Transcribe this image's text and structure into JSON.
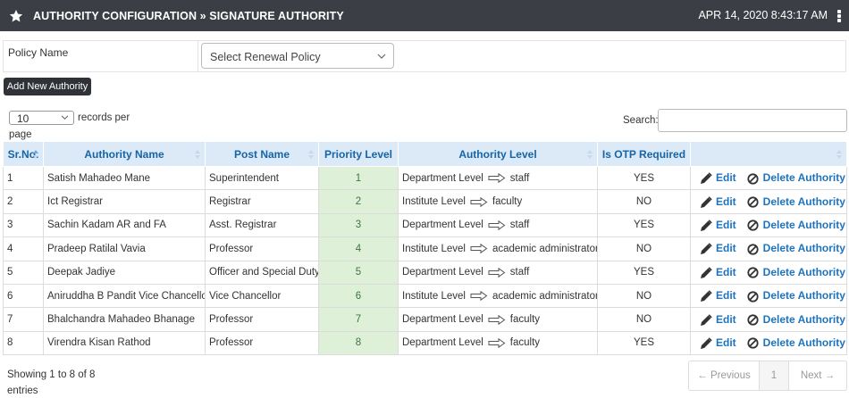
{
  "header": {
    "title": "AUTHORITY CONFIGURATION » SIGNATURE AUTHORITY",
    "datetime": "APR 14, 2020  8:43:17 AM",
    "icons": [
      "star-icon",
      "kebab-menu-icon"
    ],
    "bg_color": "#3b3f45"
  },
  "policy": {
    "label": "Policy Name",
    "select_value": "Select Renewal Policy"
  },
  "add_button_label": "Add New Authority",
  "length_menu": {
    "value": "10",
    "label_part1": "records per",
    "label_part2": "page"
  },
  "search": {
    "label": "Search:",
    "value": ""
  },
  "table": {
    "columns": [
      "Sr.No.",
      "Authority Name",
      "Post Name",
      "Priority Level",
      "Authority Level",
      "Is OTP Required",
      ""
    ],
    "rows": [
      {
        "sr": "1",
        "name": "Satish Mahadeo Mane",
        "post": "Superintendent",
        "priority": "1",
        "level_from": "Department Level",
        "level_to": "staff",
        "otp": "YES"
      },
      {
        "sr": "2",
        "name": "Ict Registrar",
        "post": "Registrar",
        "priority": "2",
        "level_from": "Institute Level",
        "level_to": "faculty",
        "otp": "NO"
      },
      {
        "sr": "3",
        "name": "Sachin Kadam AR and FA",
        "post": "Asst. Registrar",
        "priority": "3",
        "level_from": "Department Level",
        "level_to": "staff",
        "otp": "YES"
      },
      {
        "sr": "4",
        "name": "Pradeep Ratilal Vavia",
        "post": "Professor",
        "priority": "4",
        "level_from": "Institute Level",
        "level_to": "academic administrator",
        "otp": "NO"
      },
      {
        "sr": "5",
        "name": "Deepak Jadiye",
        "post": "Officer and Special Duty",
        "priority": "5",
        "level_from": "Department Level",
        "level_to": "staff",
        "otp": "YES"
      },
      {
        "sr": "6",
        "name": "Aniruddha B Pandit Vice Chancellor",
        "post": "Vice Chancellor",
        "priority": "6",
        "level_from": "Institute Level",
        "level_to": "academic administrator",
        "otp": "NO"
      },
      {
        "sr": "7",
        "name": "Bhalchandra Mahadeo Bhanage",
        "post": "Professor",
        "priority": "7",
        "level_from": "Department Level",
        "level_to": "faculty",
        "otp": "NO"
      },
      {
        "sr": "8",
        "name": "Virendra Kisan Rathod",
        "post": "Professor",
        "priority": "8",
        "level_from": "Department Level",
        "level_to": "faculty",
        "otp": "YES"
      }
    ],
    "edit_label": "Edit",
    "delete_label": "Delete Authority",
    "header_bg": "#dce9f6",
    "header_color": "#1565a8",
    "priority_bg": "#dff0d8",
    "action_color": "#1e73be"
  },
  "footer": {
    "info_part1": "Showing 1 to 8 of 8",
    "info_part2": "entries",
    "prev_label": "← Previous",
    "page_label": "1",
    "next_label": "Next →"
  }
}
